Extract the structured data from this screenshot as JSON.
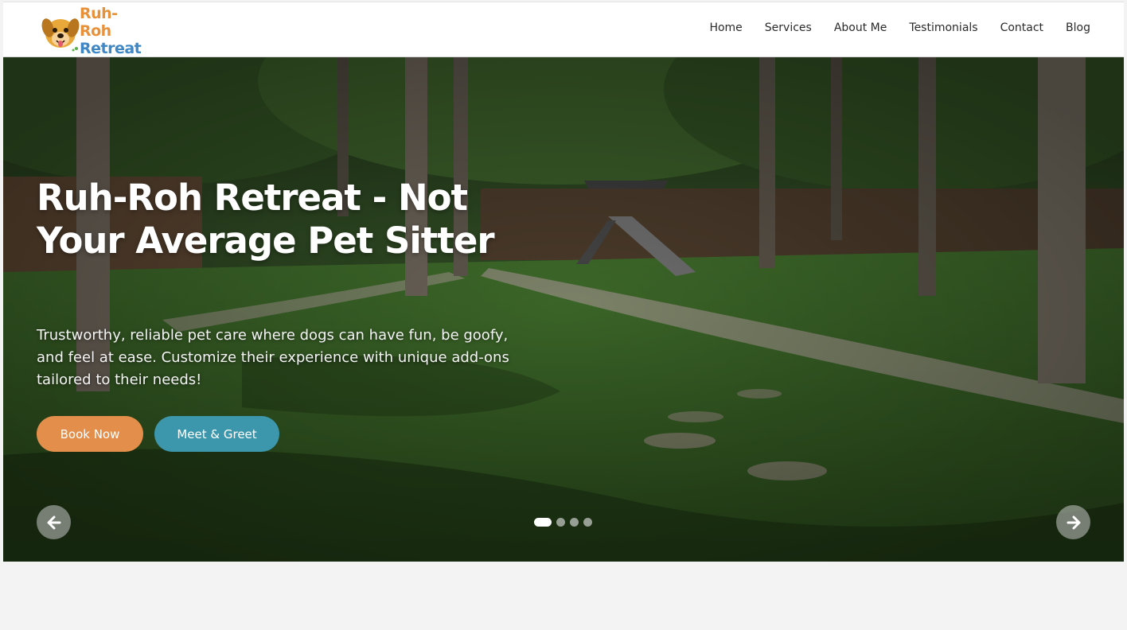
{
  "logo": {
    "line1": "Ruh-Roh",
    "line2": "Retreat",
    "icon": "dog-logo-icon"
  },
  "nav": {
    "items": [
      "Home",
      "Services",
      "About Me",
      "Testimonials",
      "Contact",
      "Blog"
    ]
  },
  "hero": {
    "title": "Ruh-Roh Retreat - Not Your Average Pet Sitter",
    "subtitle": "Trustworthy, reliable pet care where dogs can have fun, be goofy, and feel at ease. Customize their experience with unique add-ons tailored to their needs!",
    "book_label": "Book Now",
    "meet_label": "Meet & Greet",
    "prev_icon": "arrow-left-icon",
    "next_icon": "arrow-right-icon",
    "slides_count": 4,
    "active_slide": 1
  },
  "colors": {
    "book": "#e38f4b",
    "meet": "#3c97ad",
    "logo_orange": "#e8913b",
    "logo_blue": "#3f87c5"
  }
}
